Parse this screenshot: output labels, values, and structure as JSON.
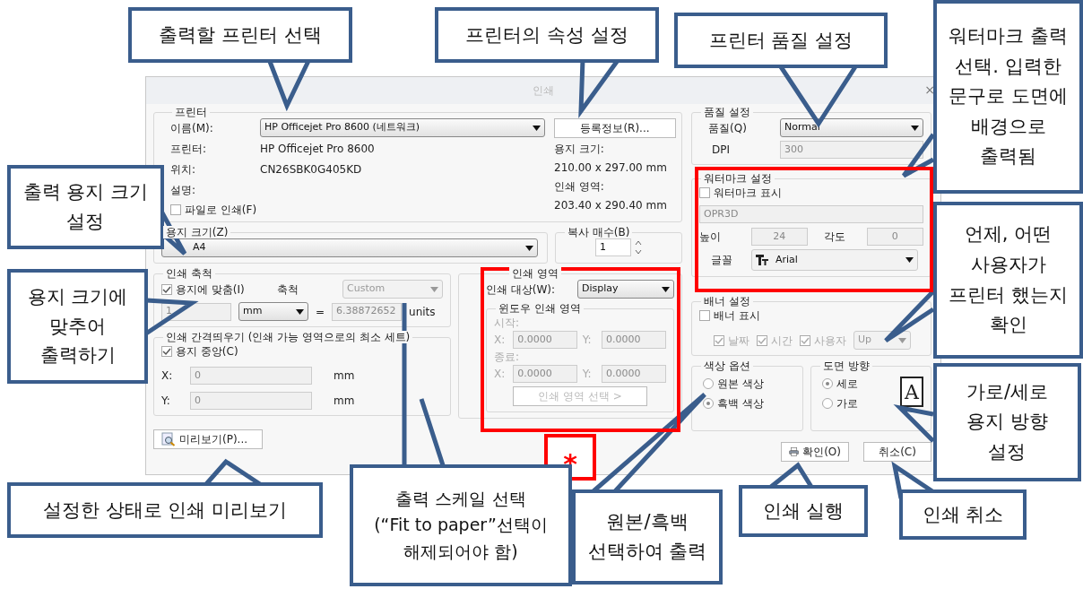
{
  "window": {
    "title": "인쇄",
    "close_glyph": "×"
  },
  "printer": {
    "legend": "프린터",
    "name_label": "이름(M):",
    "name_value": "HP Officejet Pro 8600 (네트워크)",
    "properties_button": "등록정보(R)...",
    "info": [
      {
        "label": "프린터:",
        "value": "HP Officejet Pro 8600"
      },
      {
        "label": "위치:",
        "value": "CN26SBK0G405KD"
      },
      {
        "label": "설명:"
      }
    ],
    "print_to_file": {
      "label": "파일로 인쇄(F)",
      "checked": false
    },
    "paper_size_label": "용지 크기:",
    "paper_size": "210.00 x 297.00 mm",
    "print_area_label": "인쇄 영역:",
    "print_area": "203.40 x 290.40 mm"
  },
  "paper": {
    "legend": "용지 크기(Z)",
    "value": "A4"
  },
  "copies": {
    "legend": "복사 매수(B)",
    "value": "1"
  },
  "scale": {
    "legend": "인쇄 축척",
    "fit": {
      "label": "용지에 맞춤(I)",
      "checked": true
    },
    "scale_label": "축척",
    "scale_value": "Custom",
    "units_value": "1",
    "unit": "mm",
    "equals": "=",
    "ratio": "6.38872652",
    "units_label": "units"
  },
  "offset": {
    "legend": "인쇄 간격띄우기 (인쇄 가능 영역으로의 최소 세트)",
    "center": {
      "label": "용지 중앙(C)",
      "checked": true
    },
    "rows": [
      {
        "label": "X:",
        "value": "0",
        "unit": "mm"
      },
      {
        "label": "Y:",
        "value": "0",
        "unit": "mm"
      }
    ]
  },
  "area": {
    "legend": "인쇄 영역",
    "target_label": "인쇄 대상(W):",
    "target_value": "Display",
    "window_legend": "윈도우 인쇄 영역",
    "disabled": true,
    "sections": [
      {
        "label": "시작:",
        "coords": [
          {
            "label": "X:",
            "value": "0.0000"
          },
          {
            "label": "Y:",
            "value": "0.0000"
          }
        ]
      },
      {
        "label": "종료:",
        "coords": [
          {
            "label": "X:",
            "value": "0.0000"
          },
          {
            "label": "Y:",
            "value": "0.0000"
          }
        ]
      }
    ],
    "select_button": "인쇄 영역 선택 >"
  },
  "preview_button": "미리보기(P)...",
  "quality": {
    "legend": "품질 설정",
    "quality_label": "품질(Q)",
    "quality_value": "Normal",
    "dpi_label": "DPI",
    "dpi_value": "300"
  },
  "watermark": {
    "legend": "워터마크 설정",
    "show": {
      "label": "워터마크 표시",
      "checked": false
    },
    "text_value": "OPR3D",
    "height_label": "높이",
    "height_value": "24",
    "angle_label": "각도",
    "angle_value": "0",
    "font_label": "글꼴",
    "font_value": "Arial"
  },
  "banner": {
    "legend": "배너 설정",
    "show": {
      "label": "배너 표시",
      "checked": false
    },
    "items": [
      {
        "label": "날짜",
        "checked": true,
        "disabled": true
      },
      {
        "label": "시간",
        "checked": true,
        "disabled": true
      },
      {
        "label": "사용자",
        "checked": true,
        "disabled": true
      }
    ],
    "position_value": "Up"
  },
  "color": {
    "legend": "색상 옵션",
    "options": [
      {
        "label": "원본 색상",
        "selected": false
      },
      {
        "label": "흑백 색상",
        "selected": true
      }
    ]
  },
  "orientation": {
    "legend": "도면 방향",
    "options": [
      {
        "label": "세로",
        "selected": true
      },
      {
        "label": "가로",
        "selected": false
      }
    ],
    "preview_glyph": "A"
  },
  "buttons": [
    {
      "label": "확인(O)",
      "kind": "ok"
    },
    {
      "label": "취소(C)",
      "kind": "cancel"
    }
  ],
  "callouts": [
    {
      "text": "출력할 프린터 선택"
    },
    {
      "text": "프린터의 속성 설정"
    },
    {
      "text": "프린터 품질 설정"
    },
    {
      "text": "워터마크 출력\n선택. 입력한\n문구로 도면에\n배경으로\n출력됨"
    },
    {
      "text": "출력 용지 크기\n설정"
    },
    {
      "text": "용지 크기에\n맞추어\n출력하기"
    },
    {
      "text": "언제, 어떤\n사용자가\n프린터 했는지\n확인"
    },
    {
      "text": "가로/세로\n용지 방향\n설정"
    },
    {
      "text": "설정한 상태로 인쇄 미리보기"
    },
    {
      "text": "출력 스케일 선택\n(“Fit to paper”선택이\n해제되어야 함)"
    },
    {
      "text": "원본/흑백\n선택하여 출력"
    },
    {
      "text": "인쇄 실행"
    },
    {
      "text": "인쇄 취소"
    }
  ],
  "marker": {
    "text": "*"
  }
}
